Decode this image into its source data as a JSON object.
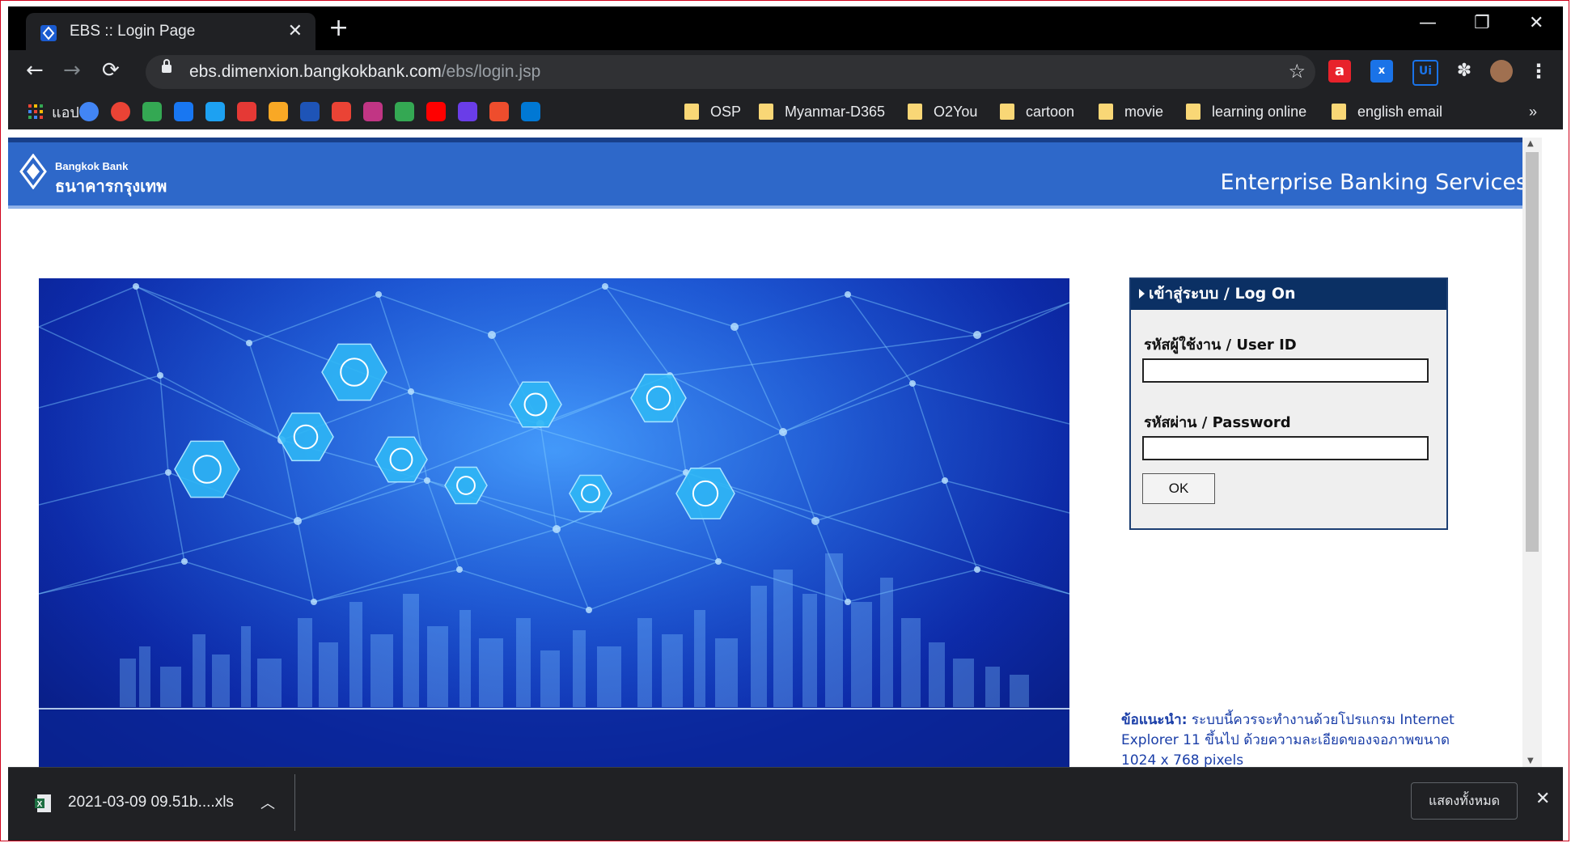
{
  "browser": {
    "tab_title": "EBS :: Login Page",
    "new_tab": "+",
    "url_host": "ebs.dimenxion.bangkokbank.com",
    "url_path": "/ebs/login.jsp",
    "window_controls": [
      "minimize-icon",
      "restore-icon",
      "close-icon"
    ],
    "extensions": [
      {
        "label": "a",
        "color": "#e8222b",
        "name": "acrobat-extension-icon"
      },
      {
        "label": "x",
        "color": "#1a73e8",
        "name": "search-extension-icon"
      },
      {
        "label": "Ui",
        "color": "#1a73e8",
        "name": "uipath-extension-icon"
      },
      {
        "label": "✽",
        "color": "#e8eaed",
        "name": "extensions-puzzle-icon"
      },
      {
        "label": "",
        "color": "#a07050",
        "name": "profile-avatar"
      },
      {
        "label": "⋮",
        "color": "#e8eaed",
        "name": "menu-kebab-icon"
      }
    ]
  },
  "bookmarks": {
    "apps_label": "แอป",
    "folders": [
      "OSP",
      "Myanmar-D365",
      "O2You",
      "cartoon",
      "movie",
      "learning online",
      "english email"
    ],
    "more": "»",
    "icon_colors": [
      "#4285f4",
      "#ea4335",
      "#34a853",
      "#1877f2",
      "#1da1f2",
      "#e53935",
      "#f9a825",
      "#1e54b7",
      "#ea4335",
      "#c13584",
      "#34a853",
      "#ff0000",
      "#6a3de8",
      "#ee4d2d",
      "#0078d4"
    ],
    "icon_names": [
      "google-translate-icon",
      "google-icon",
      "maps-icon",
      "facebook-icon",
      "twitter-icon",
      "bookmark-icon",
      "bookmark-icon-2",
      "booking-icon",
      "gmail-icon",
      "instagram-icon",
      "play-icon",
      "youtube-icon",
      "bookmark-icon-3",
      "shopee-icon",
      "onedrive-icon"
    ]
  },
  "page": {
    "brand_en": "Bangkok Bank",
    "brand_th": "ธนาคารกรุงเทพ",
    "service_title": "Enterprise Banking Services",
    "logon_header": "เข้าสู่ระบบ / Log On",
    "user_id_label": "รหัสผู้ใช้งาน / User ID",
    "password_label": "รหัสผ่าน / Password",
    "user_id_value": "",
    "password_value": "",
    "ok_label": "OK",
    "advice_prefix": "ข้อแนะนำ:",
    "advice_text": " ระบบนี้ควรจะทำงานด้วยโปรแกรม Internet Explorer 11 ขึ้นไป ด้วยความละเอียดของจอภาพขนาด 1024 x 768 pixels",
    "hero_icons": [
      "mobile-banking-icon",
      "global-money-icon",
      "coin-cursor-icon",
      "growth-chart-icon",
      "security-lock-icon",
      "handshake-icon",
      "team-icon",
      "block-icon",
      "cloud-transfer-icon"
    ]
  },
  "download": {
    "filename": "2021-03-09 09.51b....xls",
    "show_all": "แสดงทั้งหมด"
  }
}
